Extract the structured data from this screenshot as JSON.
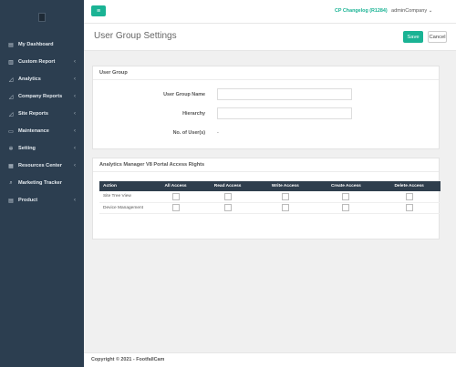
{
  "sidebar": {
    "items": [
      {
        "label": "My Dashboard",
        "icon": "dashboard-icon",
        "arrow": ""
      },
      {
        "label": "Custom Report",
        "icon": "report-icon",
        "arrow": "‹"
      },
      {
        "label": "Analytics",
        "icon": "analytics-icon",
        "arrow": "‹"
      },
      {
        "label": "Company Reports",
        "icon": "chart-icon",
        "arrow": "‹"
      },
      {
        "label": "Site Reports",
        "icon": "chart-icon",
        "arrow": "‹"
      },
      {
        "label": "Maintenance",
        "icon": "monitor-icon",
        "arrow": "‹"
      },
      {
        "label": "Setting",
        "icon": "gear-icon",
        "arrow": "‹"
      },
      {
        "label": "Resources Center",
        "icon": "folder-icon",
        "arrow": "‹"
      },
      {
        "label": "Marketing Tracker",
        "icon": "search-icon",
        "arrow": ""
      },
      {
        "label": "Product",
        "icon": "product-icon",
        "arrow": "‹"
      }
    ]
  },
  "topbar": {
    "menu_glyph": "≡",
    "changelog": "CP Changelog (R1284)",
    "company": "adminCompany ⌄"
  },
  "header": {
    "title": "User Group Settings",
    "save_label": "Save",
    "cancel_label": "Cancel"
  },
  "user_group": {
    "title": "User Group",
    "name_label": "User Group Name",
    "name_value": "",
    "hierarchy_label": "Hierarchy",
    "hierarchy_value": "",
    "users_label": "No. of User(s)",
    "users_value": "-"
  },
  "rights": {
    "title": "Analytics Manager V8 Portal Access Rights",
    "columns": [
      "Action",
      "All Access",
      "Read Access",
      "Write Access",
      "Create Access",
      "Delete Access"
    ],
    "rows": [
      {
        "action": "Site Tree View"
      },
      {
        "action": "Device Management"
      }
    ]
  },
  "footer": {
    "text": "Copyright © 2021 - FootfallCam"
  },
  "colors": {
    "sidebar_bg": "#2c3e50",
    "accent": "#1ab394",
    "table_header": "#2f3e4d"
  }
}
